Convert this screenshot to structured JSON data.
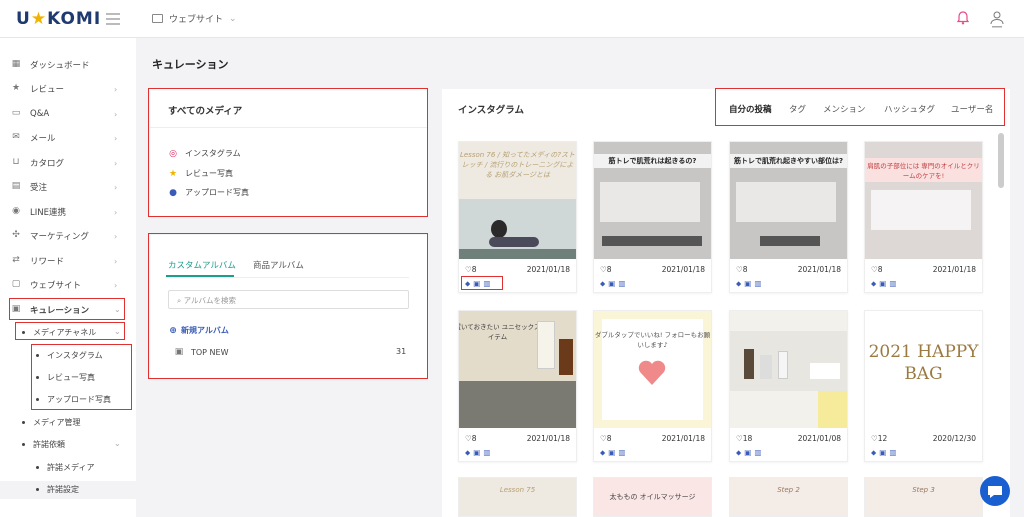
{
  "topbar": {
    "logo_a": "U",
    "logo_star": "★",
    "logo_b": "KOMI",
    "site_selector": "ウェブサイト"
  },
  "sidebar": {
    "items": [
      {
        "label": "ダッシュボード",
        "icon": "dashboard-icon"
      },
      {
        "label": "レビュー",
        "icon": "star-icon"
      },
      {
        "label": "Q&A",
        "icon": "chat-icon"
      },
      {
        "label": "メール",
        "icon": "mail-icon"
      },
      {
        "label": "カタログ",
        "icon": "cart-icon"
      },
      {
        "label": "受注",
        "icon": "order-icon"
      },
      {
        "label": "LINE連携",
        "icon": "line-icon"
      },
      {
        "label": "マーケティング",
        "icon": "marketing-icon"
      },
      {
        "label": "リワード",
        "icon": "reward-icon"
      },
      {
        "label": "ウェブサイト",
        "icon": "website-icon"
      },
      {
        "label": "キュレーション",
        "icon": "curation-icon"
      }
    ],
    "media_channel": "メディアチャネル",
    "media_channel_items": [
      "インスタグラム",
      "レビュー写真",
      "アップロード写真"
    ],
    "media_manage": "メディア管理",
    "permission": "許諾依頼",
    "permission_items": [
      "許諾メディア",
      "許諾設定"
    ]
  },
  "page": {
    "title": "キュレーション"
  },
  "all_media": {
    "title": "すべてのメディア",
    "items": [
      {
        "label": "インスタグラム",
        "icon": "instagram-icon"
      },
      {
        "label": "レビュー写真",
        "icon": "star-icon"
      },
      {
        "label": "アップロード写真",
        "icon": "user-icon"
      }
    ]
  },
  "albums": {
    "tabs": [
      "カスタムアルバム",
      "商品アルバム"
    ],
    "search_placeholder": "アルバムを検索",
    "new_album": "新規アルバム",
    "list": [
      {
        "name": "TOP NEW",
        "count": "31"
      }
    ]
  },
  "instagram": {
    "title": "インスタグラム",
    "tabs": [
      "自分の投稿",
      "タグ",
      "メンション",
      "ハッシュタグ",
      "ユーザー名"
    ],
    "posts": [
      {
        "likes": "♡8",
        "date": "2021/01/18",
        "caption": "Lesson 76 / 知ってたメディの?ストレッチ / 流行りのトレーニングによる お肌ダメージとは"
      },
      {
        "likes": "♡8",
        "date": "2021/01/18",
        "caption": "筋トレで肌荒れは起きるの?"
      },
      {
        "likes": "♡8",
        "date": "2021/01/18",
        "caption": "筋トレで肌荒れ起きやすい部位は?"
      },
      {
        "likes": "♡8",
        "date": "2021/01/18",
        "caption": "肩肌の子部位には 専門のオイルとクリームのケアを!"
      },
      {
        "likes": "♡8",
        "date": "2021/01/18",
        "caption": "家に置いておきたい ユニセックスなアイテム"
      },
      {
        "likes": "♡8",
        "date": "2021/01/18",
        "caption": "ダブルタップでいいね! フォローもお願いします♪"
      },
      {
        "likes": "♡18",
        "date": "2021/01/08",
        "caption": ""
      },
      {
        "likes": "♡12",
        "date": "2020/12/30",
        "caption": "2021 HAPPY BAG"
      }
    ],
    "row3": [
      "Lesson 75",
      "太ももの オイルマッサージ",
      "Step 2",
      "Step 3"
    ]
  }
}
